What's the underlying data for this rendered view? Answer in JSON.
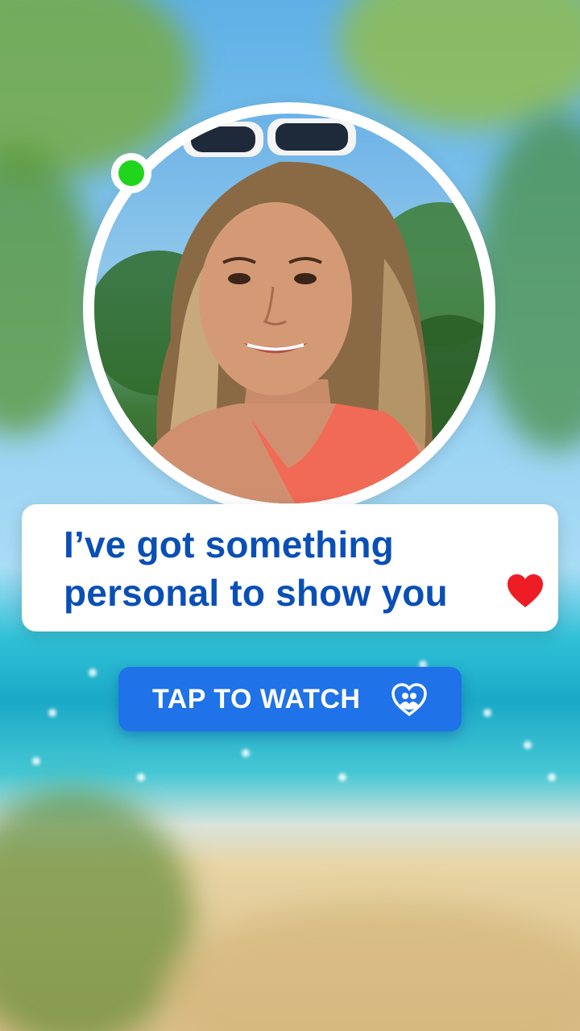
{
  "message": {
    "line1": "I’ve got something",
    "line2": "personal to show you"
  },
  "icons": {
    "heart": "heart-icon",
    "cta": "heart-couple-icon",
    "status": "online-status-icon"
  },
  "cta": {
    "label": "TAP TO WATCH"
  },
  "colors": {
    "message_text": "#0a4fb6",
    "heart": "#ee1c25",
    "button": "#1f72e8",
    "online": "#21d51f"
  }
}
